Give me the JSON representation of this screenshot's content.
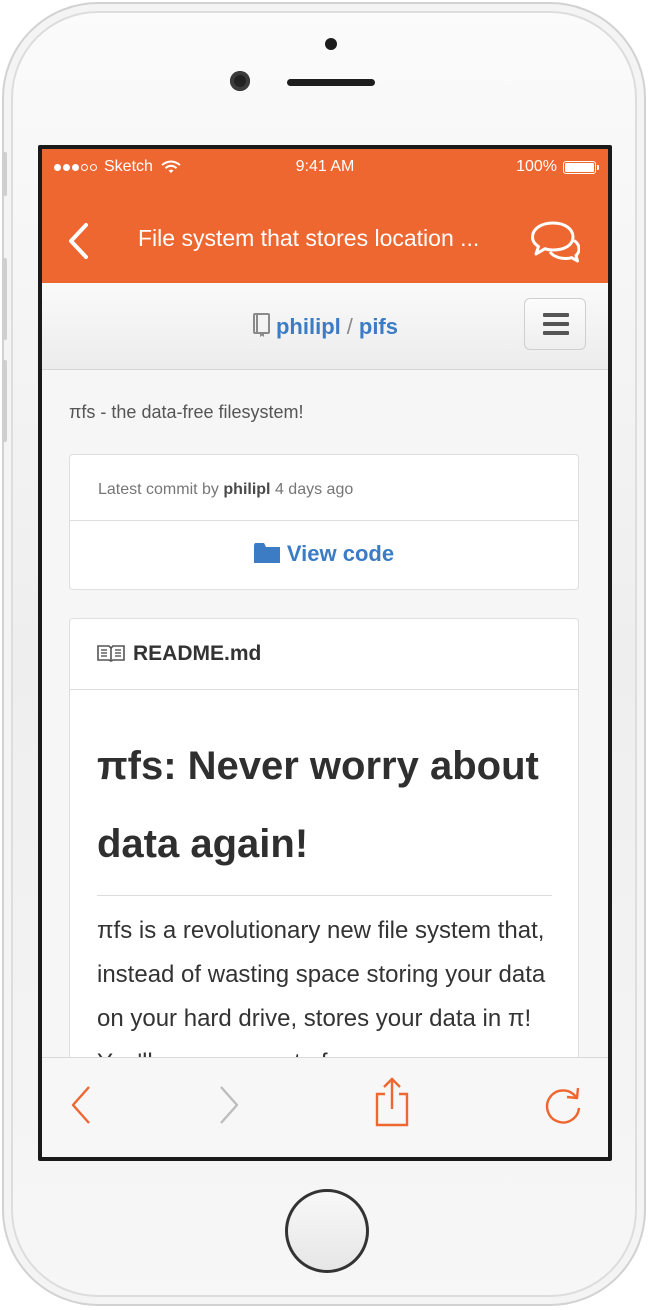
{
  "status_bar": {
    "carrier": "Sketch",
    "time": "9:41 AM",
    "battery": "100%"
  },
  "nav": {
    "title": "File system that stores location ..."
  },
  "repo": {
    "owner": "philipl",
    "separator": "/",
    "name": "pifs"
  },
  "description": "πfs - the data-free filesystem!",
  "commit": {
    "prefix": "Latest commit by",
    "author": "philipl",
    "age": "4 days ago",
    "view_code_label": "View code"
  },
  "readme": {
    "filename": "README.md",
    "heading": "πfs: Never worry about data again!",
    "paragraph": "πfs is a revolutionary new file system that, instead of wasting space storing your data on your hard drive, stores your data in π! You'll never run out of"
  },
  "colors": {
    "accent": "#ee6630",
    "link": "#3b7cc4"
  },
  "icons": {
    "back": "chevron-left-icon",
    "comments": "speech-bubbles-icon",
    "menu": "hamburger-icon",
    "repo": "book-icon",
    "folder": "folder-icon",
    "readme": "open-book-icon",
    "toolbar": [
      "back-arrow-icon",
      "forward-arrow-icon",
      "share-icon",
      "refresh-icon"
    ]
  }
}
